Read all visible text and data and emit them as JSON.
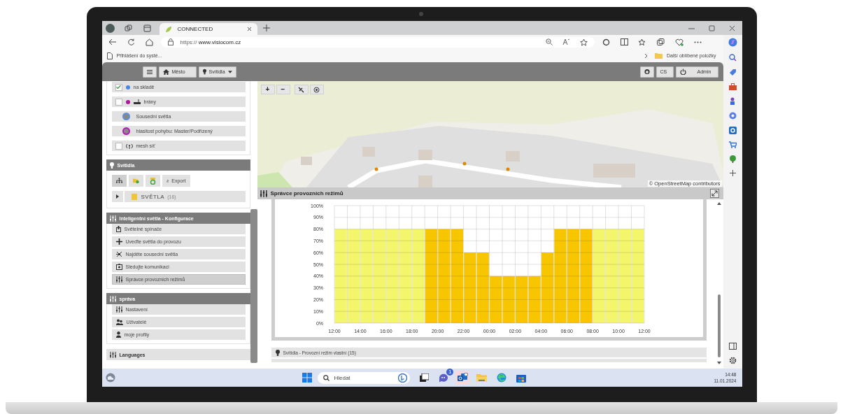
{
  "browser": {
    "tab": {
      "title": "CONNECTED",
      "selected": true
    },
    "url": {
      "scheme": "https://",
      "host": "www.visiocom.cz"
    },
    "favorites": [
      "Přihlášení do systé..."
    ],
    "more_favorites": "Další oblíbené položky"
  },
  "toolbar": {
    "city": "Město",
    "layer": "Svítidla",
    "language": "CS",
    "user": "Admin"
  },
  "sidebar": {
    "layers": [
      {
        "kind": "dot",
        "label": "na skladě",
        "checked": true,
        "color": "#4a86e8"
      },
      {
        "kind": "gateway",
        "label": "brány",
        "checked": false,
        "color": "#b0169c"
      },
      {
        "kind": "ring",
        "label": "Sousední světla",
        "color": "#5b8de0"
      },
      {
        "kind": "ring",
        "label": "hlasitost pohybu: Master/Podřízený",
        "color": "#c010c0"
      },
      {
        "kind": "mesh",
        "label": "mesh síť",
        "checked": false
      }
    ],
    "lights": {
      "title": "Svítidla",
      "export": "Export",
      "tree": {
        "label": "SVĚTLA",
        "count": "(16)",
        "expanded": false
      }
    },
    "config": {
      "title": "Inteligentní světla - Konfigurace",
      "items": [
        {
          "label": "Světelné spínače",
          "selected": false
        },
        {
          "label": "Uveďte světla do provozu",
          "selected": false
        },
        {
          "label": "Najděte sousední světla",
          "selected": false
        },
        {
          "label": "Sledujte komunikaci",
          "selected": false
        },
        {
          "label": "Správce provozních režimů",
          "selected": true
        }
      ]
    },
    "admin": {
      "title": "správa",
      "items": [
        {
          "label": "Nastavení",
          "selected": false
        },
        {
          "label": "Uživatelé",
          "selected": false
        },
        {
          "label": "moje profily",
          "selected": false
        }
      ]
    },
    "languages": "Languages"
  },
  "map": {
    "zoom_in": "+",
    "zoom_out": "−",
    "attribution": "© OpenStreetMap contributors"
  },
  "modes_panel": {
    "title": "Správce provozních režimů",
    "chart_data": {
      "type": "bar",
      "grid": true,
      "categories": [
        "12:00",
        null,
        "14:00",
        null,
        "16:00",
        null,
        "18:00",
        null,
        "20:00",
        null,
        "22:00",
        null,
        "00:00",
        null,
        "02:00",
        null,
        "04:00",
        null,
        "06:00",
        null,
        "08:00",
        null,
        "10:00",
        null,
        "12:00"
      ],
      "series": [
        {
          "color": "#f3f56b",
          "values": [
            80,
            80,
            80,
            80,
            80,
            80,
            80,
            null,
            null,
            null,
            null,
            null,
            null,
            null,
            null,
            null,
            null,
            null,
            null,
            null,
            80,
            80,
            80,
            80,
            null
          ]
        },
        {
          "color": "#f7c600",
          "values": [
            null,
            null,
            null,
            null,
            null,
            null,
            null,
            80,
            80,
            80,
            60,
            60,
            40,
            40,
            40,
            40,
            60,
            80,
            80,
            80,
            null,
            null,
            null,
            null,
            null
          ]
        }
      ],
      "ylim": [
        0,
        100
      ],
      "yticks": [
        {
          "value": 0,
          "label": "0%"
        },
        {
          "value": 10,
          "label": "10%"
        },
        {
          "value": 20,
          "label": "20%"
        },
        {
          "value": 30,
          "label": "30%"
        },
        {
          "value": 40,
          "label": "40%"
        },
        {
          "value": 50,
          "label": "50%"
        },
        {
          "value": 60,
          "label": "60%"
        },
        {
          "value": 70,
          "label": "70%"
        },
        {
          "value": 80,
          "label": "80%"
        },
        {
          "value": 90,
          "label": "90%"
        },
        {
          "value": 100,
          "label": "100%"
        }
      ]
    },
    "footer": "Svítidla - Provozní režim vlastní (15)"
  },
  "taskbar": {
    "search_placeholder": "Hledat",
    "badge": "1",
    "time": "14:48",
    "date": "11.01.2024"
  }
}
